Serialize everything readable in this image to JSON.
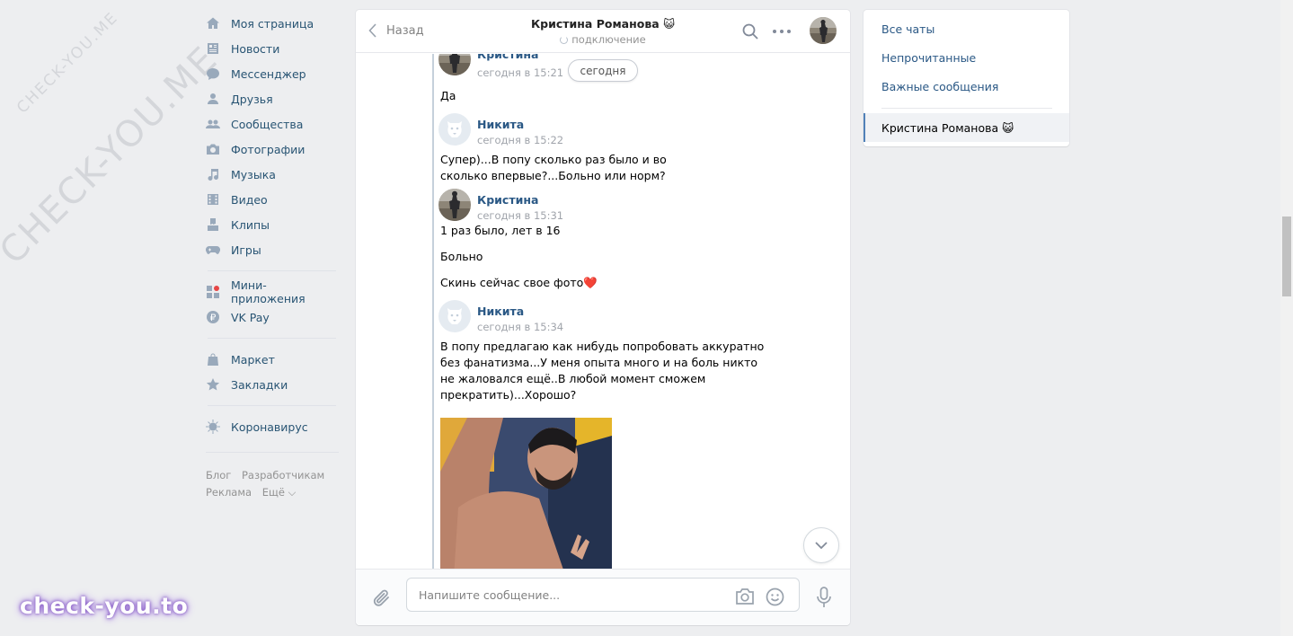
{
  "watermark": {
    "diagonal": "CHECK-YOU.ME",
    "bottom": "check-you.to"
  },
  "nav": {
    "items": [
      {
        "label": "Моя страница",
        "icon": "home-icon"
      },
      {
        "label": "Новости",
        "icon": "news-icon"
      },
      {
        "label": "Мессенджер",
        "icon": "messenger-icon"
      },
      {
        "label": "Друзья",
        "icon": "friends-icon"
      },
      {
        "label": "Сообщества",
        "icon": "communities-icon"
      },
      {
        "label": "Фотографии",
        "icon": "camera-icon"
      },
      {
        "label": "Музыка",
        "icon": "music-icon"
      },
      {
        "label": "Видео",
        "icon": "video-icon"
      },
      {
        "label": "Клипы",
        "icon": "clips-icon"
      },
      {
        "label": "Игры",
        "icon": "gamepad-icon"
      }
    ],
    "items2": [
      {
        "label": "Мини-приложения",
        "icon": "apps-icon"
      },
      {
        "label": "VK Pay",
        "icon": "vkpay-icon"
      }
    ],
    "items3": [
      {
        "label": "Маркет",
        "icon": "bag-icon"
      },
      {
        "label": "Закладки",
        "icon": "star-icon"
      }
    ],
    "items4": [
      {
        "label": "Коронавирус",
        "icon": "virus-icon"
      }
    ],
    "footer": {
      "blog": "Блог",
      "devs": "Разработчикам",
      "ads": "Реклама",
      "more": "Ещё ⌵"
    }
  },
  "chat": {
    "back_label": "Назад",
    "title": "Кристина Романова 😺",
    "status": "подключение",
    "date_pill": "сегодня",
    "composer_placeholder": "Напишите сообщение...",
    "messages": [
      {
        "author": "Кристина",
        "time": "сегодня в 15:21",
        "lines": [
          "Да"
        ]
      },
      {
        "author": "Никита",
        "time": "сегодня в 15:22",
        "text": "Супер)...В попу сколько раз было и во сколько впервые?...Больно или норм?"
      },
      {
        "author": "Кристина",
        "time": "сегодня в 15:31",
        "lines": [
          "1 раз было, лет в 16",
          "Больно",
          "Скинь сейчас свое фото❤️"
        ]
      },
      {
        "author": "Никита",
        "time": "сегодня в 15:34",
        "text": "В попу предлагаю как нибудь попробовать аккуратно без фанатизма...У меня опыта много и на боль никто не жаловался ещё..В любой момент сможем прекратить)...Хорошо?"
      }
    ]
  },
  "right_panel": {
    "all_chats": "Все чаты",
    "unread": "Непрочитанные",
    "important": "Важные сообщения",
    "active_chat": "Кристина Романова 😺"
  },
  "colors": {
    "link": "#2a5885",
    "nav_text": "#285473",
    "icon": "#99a9bb",
    "background": "#edeef0"
  }
}
